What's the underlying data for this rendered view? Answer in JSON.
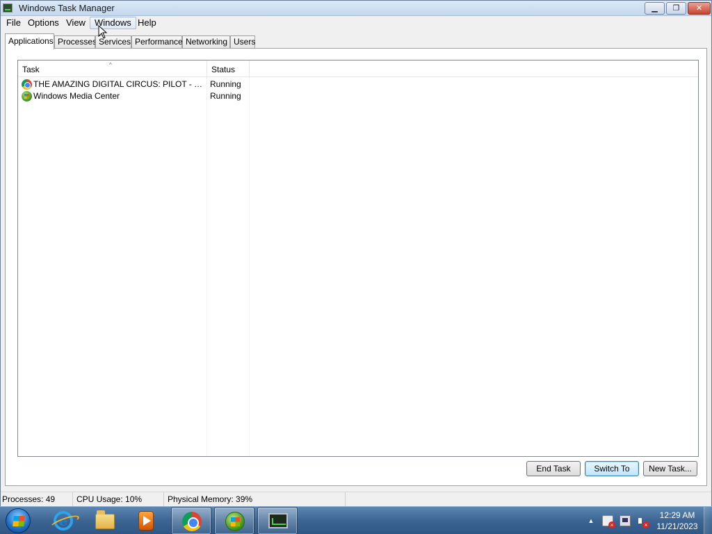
{
  "window": {
    "title": "Windows Task Manager",
    "controls": {
      "minimize": "▁",
      "maximize": "❐",
      "close": "✕"
    }
  },
  "menubar": {
    "items": [
      "File",
      "Options",
      "View",
      "Windows",
      "Help"
    ]
  },
  "tabs": [
    "Applications",
    "Processes",
    "Services",
    "Performance",
    "Networking",
    "Users"
  ],
  "active_tab": "Applications",
  "listview": {
    "columns": [
      "Task",
      "Status"
    ],
    "rows": [
      {
        "task": "THE AMAZING DIGITAL CIRCUS: PILOT - YouTu...",
        "status": "Running",
        "icon": "chrome-icon"
      },
      {
        "task": "Windows Media Center",
        "status": "Running",
        "icon": "windows-media-center-icon"
      }
    ]
  },
  "buttons": {
    "end_task": "End Task",
    "switch_to": "Switch To",
    "new_task": "New Task..."
  },
  "statusbar": {
    "processes": "Processes: 49",
    "cpu": "CPU Usage: 10%",
    "memory": "Physical Memory: 39%"
  },
  "taskbar": {
    "pinned": [
      "internet-explorer-icon",
      "windows-explorer-icon",
      "media-player-icon",
      "chrome-icon",
      "windows-media-center-icon",
      "task-manager-icon"
    ],
    "tray_arrow": "▲",
    "clock": {
      "time": "12:29 AM",
      "date": "11/21/2023"
    }
  },
  "colors": {
    "taskbar": "#3c6593",
    "default_button": "#bee6fd",
    "close_button": "#c7432d"
  }
}
